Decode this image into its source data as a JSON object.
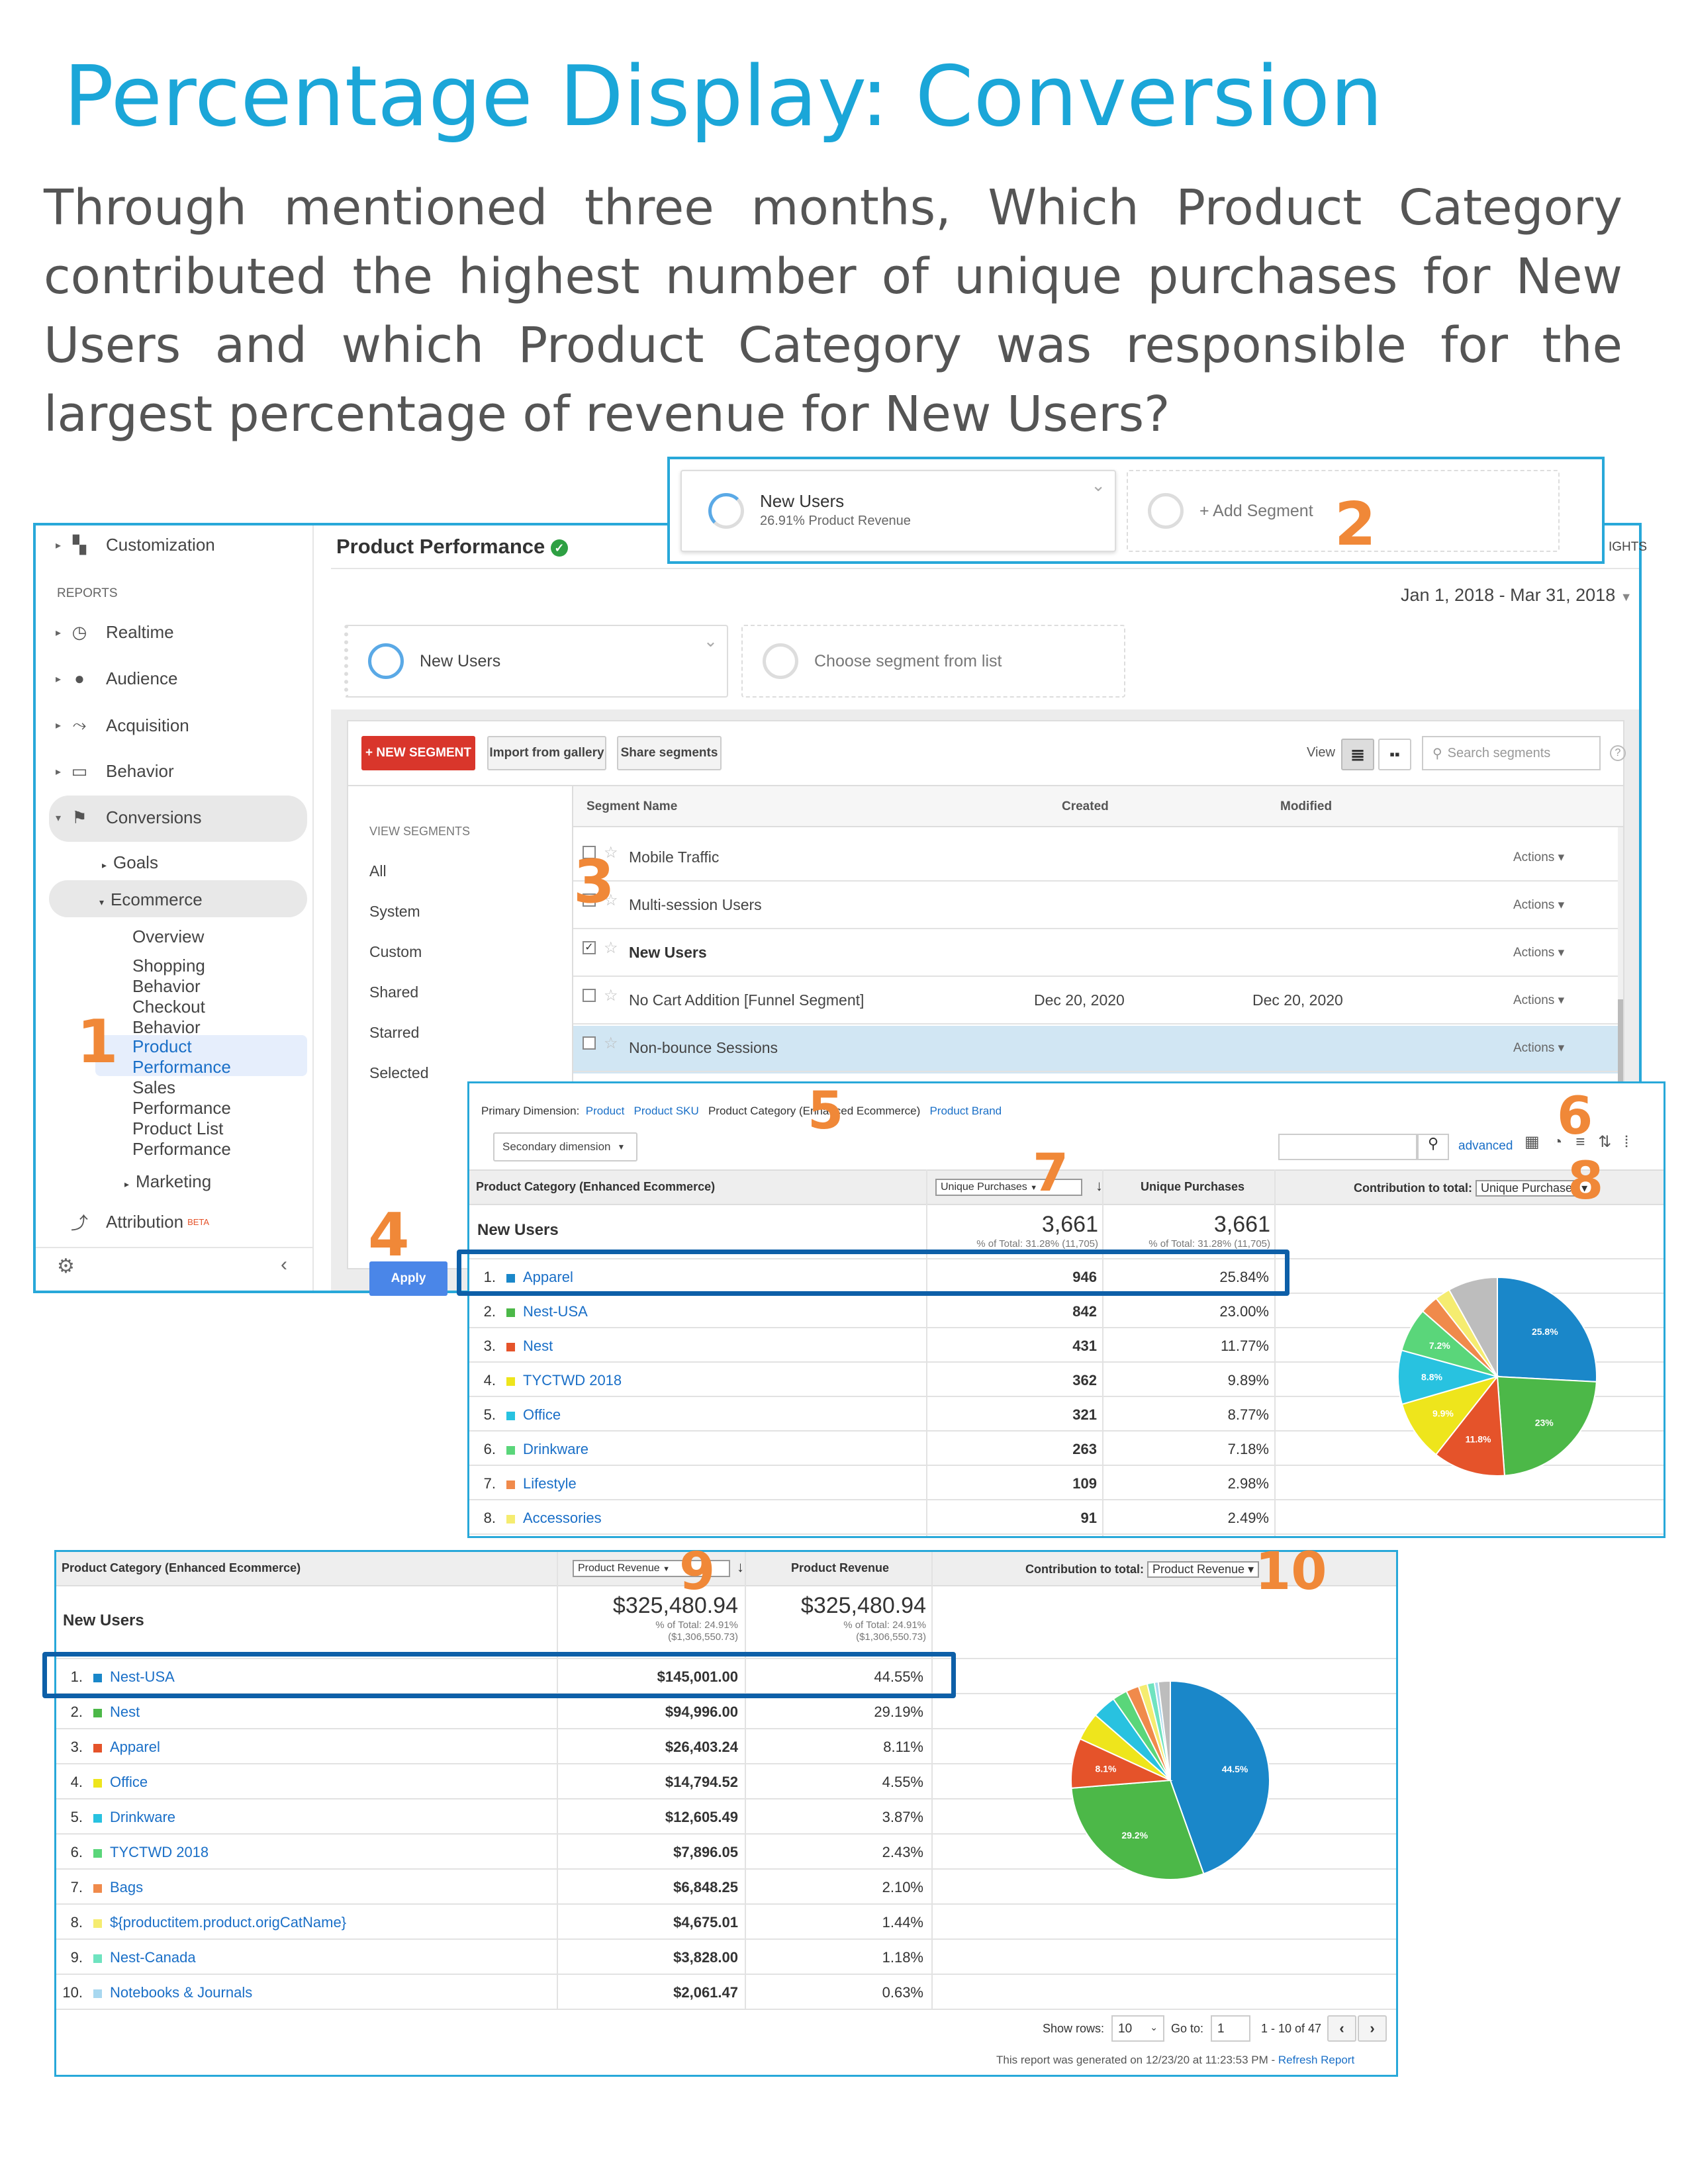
{
  "title": "Percentage Display: Conversion",
  "question": "Through mentioned three months, Which Product Category contributed the highest number of unique purchases for New Users and which Product Category was responsible for the largest percentage of revenue for New Users?",
  "step_numbers": {
    "n1": "1",
    "n2": "2",
    "n3": "3",
    "n4": "4",
    "n5": "5",
    "n6": "6",
    "n7": "7",
    "n8": "8",
    "n9": "9",
    "n10": "10"
  },
  "sidebar": {
    "customization": "Customization",
    "reports_label": "REPORTS",
    "realtime": "Realtime",
    "audience": "Audience",
    "acquisition": "Acquisition",
    "behavior": "Behavior",
    "conversions": "Conversions",
    "goals": "Goals",
    "ecommerce": "Ecommerce",
    "overview": "Overview",
    "shopping_behavior": "Shopping Behavior",
    "checkout_behavior": "Checkout Behavior",
    "product_performance": "Product Performance",
    "sales_performance": "Sales Performance",
    "product_list_performance": "Product List Performance",
    "marketing": "Marketing",
    "attribution": "Attribution",
    "beta": "BETA"
  },
  "report": {
    "title": "Product Performance",
    "insights": "IGHTS",
    "date_range": "Jan 1, 2018 - Mar 31, 2018"
  },
  "segment_popup": {
    "name": "New Users",
    "sub": "26.91% Product Revenue",
    "add": "+ Add Segment"
  },
  "segment_bar": {
    "current": "New Users",
    "choose": "Choose segment from list"
  },
  "segment_picker": {
    "new_segment": "+ NEW SEGMENT",
    "import": "Import from gallery",
    "share": "Share segments",
    "view": "View",
    "search_placeholder": "Search segments",
    "help": "?",
    "view_segments": "VIEW SEGMENTS",
    "filters": [
      "All",
      "System",
      "Custom",
      "Shared",
      "Starred",
      "Selected"
    ],
    "headers": {
      "name": "Segment Name",
      "created": "Created",
      "modified": "Modified"
    },
    "rows": [
      {
        "name": "Mobile Traffic",
        "created": "",
        "modified": "",
        "actions": "Actions",
        "checked": false
      },
      {
        "name": "Multi-session Users",
        "created": "",
        "modified": "",
        "actions": "Actions",
        "checked": false
      },
      {
        "name": "New Users",
        "created": "",
        "modified": "",
        "actions": "Actions",
        "checked": true
      },
      {
        "name": "No Cart Addition [Funnel Segment]",
        "created": "Dec 20, 2020",
        "modified": "Dec 20, 2020",
        "actions": "Actions",
        "checked": false
      },
      {
        "name": "Non-bounce Sessions",
        "created": "",
        "modified": "",
        "actions": "Actions",
        "checked": false
      }
    ],
    "apply": "Apply"
  },
  "table1": {
    "primary_dimension_label": "Primary Dimension:",
    "dims": [
      "Product",
      "Product SKU",
      "Product Category (Enhanced Ecommerce)",
      "Product Brand"
    ],
    "secondary_dimension": "Secondary dimension",
    "advanced": "advanced",
    "col_dim": "Product Category (Enhanced Ecommerce)",
    "col_sort": "Unique Purchases",
    "col_metric": "Unique Purchases",
    "contribution_label": "Contribution to total:",
    "contribution_select": "Unique Purchases",
    "segment": "New Users",
    "total": "3,661",
    "total_sub": "% of Total: 31.28% (11,705)",
    "rows": [
      {
        "rank": "1.",
        "name": "Apparel",
        "value": "946",
        "pct": "25.84%",
        "color": "#1a87c9"
      },
      {
        "rank": "2.",
        "name": "Nest-USA",
        "value": "842",
        "pct": "23.00%",
        "color": "#4cb848"
      },
      {
        "rank": "3.",
        "name": "Nest",
        "value": "431",
        "pct": "11.77%",
        "color": "#e5532a"
      },
      {
        "rank": "4.",
        "name": "TYCTWD 2018",
        "value": "362",
        "pct": "9.89%",
        "color": "#eee51c"
      },
      {
        "rank": "5.",
        "name": "Office",
        "value": "321",
        "pct": "8.77%",
        "color": "#28c2e0"
      },
      {
        "rank": "6.",
        "name": "Drinkware",
        "value": "263",
        "pct": "7.18%",
        "color": "#5ad67a"
      },
      {
        "rank": "7.",
        "name": "Lifestyle",
        "value": "109",
        "pct": "2.98%",
        "color": "#f08a4b"
      },
      {
        "rank": "8.",
        "name": "Accessories",
        "value": "91",
        "pct": "2.49%",
        "color": "#f5ec70"
      }
    ],
    "pie_labels": [
      "25.8%",
      "23%",
      "11.8%",
      "9.9%",
      "8.8%",
      "7.2%"
    ]
  },
  "table2": {
    "col_dim": "Product Category (Enhanced Ecommerce)",
    "col_sort": "Product Revenue",
    "col_metric": "Product Revenue",
    "contribution_label": "Contribution to total:",
    "contribution_select": "Product Revenue",
    "segment": "New Users",
    "total": "$325,480.94",
    "total_sub1": "% of Total: 24.91%",
    "total_sub2": "($1,306,550.73)",
    "rows": [
      {
        "rank": "1.",
        "name": "Nest-USA",
        "value": "$145,001.00",
        "pct": "44.55%",
        "color": "#1a87c9"
      },
      {
        "rank": "2.",
        "name": "Nest",
        "value": "$94,996.00",
        "pct": "29.19%",
        "color": "#4cb848"
      },
      {
        "rank": "3.",
        "name": "Apparel",
        "value": "$26,403.24",
        "pct": "8.11%",
        "color": "#e5532a"
      },
      {
        "rank": "4.",
        "name": "Office",
        "value": "$14,794.52",
        "pct": "4.55%",
        "color": "#eee51c"
      },
      {
        "rank": "5.",
        "name": "Drinkware",
        "value": "$12,605.49",
        "pct": "3.87%",
        "color": "#28c2e0"
      },
      {
        "rank": "6.",
        "name": "TYCTWD 2018",
        "value": "$7,896.05",
        "pct": "2.43%",
        "color": "#5ad67a"
      },
      {
        "rank": "7.",
        "name": "Bags",
        "value": "$6,848.25",
        "pct": "2.10%",
        "color": "#f08a4b"
      },
      {
        "rank": "8.",
        "name": "${productitem.product.origCatName}",
        "value": "$4,675.01",
        "pct": "1.44%",
        "color": "#f5ec70"
      },
      {
        "rank": "9.",
        "name": "Nest-Canada",
        "value": "$3,828.00",
        "pct": "1.18%",
        "color": "#6fe3c0"
      },
      {
        "rank": "10.",
        "name": "Notebooks & Journals",
        "value": "$2,061.47",
        "pct": "0.63%",
        "color": "#a8d8f0"
      }
    ],
    "pie_labels": [
      "44.5%",
      "29.2%",
      "8.1%"
    ],
    "show_rows_label": "Show rows:",
    "show_rows_value": "10",
    "goto_label": "Go to:",
    "goto_value": "1",
    "range": "1 - 10 of 47",
    "footer": "This report was generated on 12/23/20 at 11:23:53 PM - ",
    "refresh": "Refresh Report"
  },
  "chart_data": [
    {
      "type": "pie",
      "categories": [
        "Apparel",
        "Nest-USA",
        "Nest",
        "TYCTWD 2018",
        "Office",
        "Drinkware",
        "Lifestyle",
        "Accessories",
        "Other"
      ],
      "values": [
        25.84,
        23.0,
        11.77,
        9.89,
        8.77,
        7.18,
        2.98,
        2.49,
        8.08
      ]
    },
    {
      "type": "pie",
      "categories": [
        "Nest-USA",
        "Nest",
        "Apparel",
        "Office",
        "Drinkware",
        "TYCTWD 2018",
        "Bags",
        "${productitem.product.origCatName}",
        "Nest-Canada",
        "Notebooks & Journals",
        "Other"
      ],
      "values": [
        44.55,
        29.19,
        8.11,
        4.55,
        3.87,
        2.43,
        2.1,
        1.44,
        1.18,
        0.63,
        1.95
      ]
    }
  ]
}
